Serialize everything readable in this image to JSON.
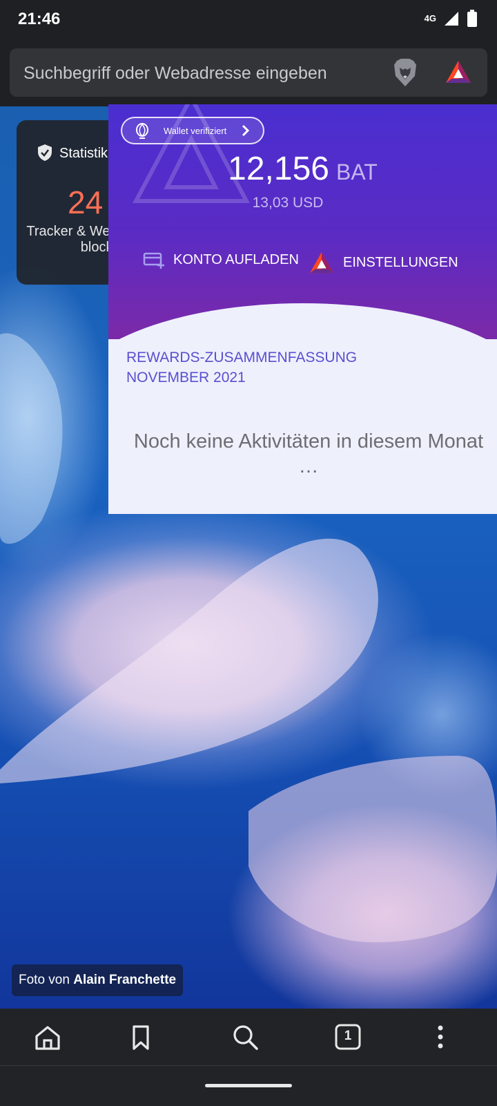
{
  "status": {
    "time": "21:46",
    "network": "4G"
  },
  "urlbar": {
    "placeholder": "Suchbegriff oder Webadresse eingeben"
  },
  "stats_card": {
    "title": "Statistik",
    "count": "24",
    "description": "Tracker & Werbeanzeigen blockiert"
  },
  "rewards": {
    "wallet_label": "Wallet verifiziert",
    "balance_amount": "12,156",
    "balance_unit": "BAT",
    "balance_usd": "13,03 USD",
    "add_funds_label": "KONTO AUFLADEN",
    "settings_label": "EINSTELLUNGEN",
    "summary_line1": "REWARDS-ZUSAMMENFASSUNG",
    "summary_line2": "NOVEMBER 2021",
    "empty_message": "Noch keine Aktivitäten in diesem Monat …"
  },
  "photo_credit": {
    "prefix": "Foto von ",
    "author": "Alain Franchette"
  },
  "bottom_nav": {
    "tab_count": "1",
    "icons": [
      "home-icon",
      "bookmark-icon",
      "search-icon",
      "tabs-icon",
      "more-icon"
    ]
  },
  "colors": {
    "accent_purple": "#4a2ed0",
    "stats_orange": "#fb6f54",
    "summary_title": "#5a4fd0"
  }
}
